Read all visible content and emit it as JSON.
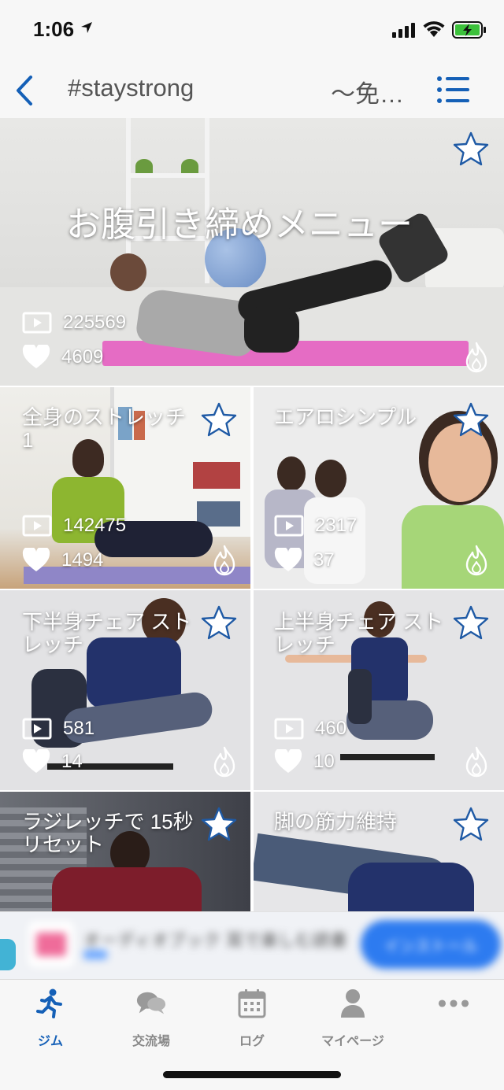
{
  "status": {
    "time": "1:06"
  },
  "nav": {
    "title": "#staystrong",
    "subtitle": "〜免…"
  },
  "hero": {
    "title": "お腹引き締めメニュー",
    "plays": "225569",
    "likes": "4609"
  },
  "cards": [
    {
      "title": "全身のストレッチ1",
      "plays": "142475",
      "likes": "1494"
    },
    {
      "title": "エアロシンプル",
      "plays": "2317",
      "likes": "37"
    },
    {
      "title": "下半身チェア ストレッチ",
      "plays": "581",
      "likes": "14"
    },
    {
      "title": "上半身チェア ストレッチ",
      "plays": "460",
      "likes": "10"
    },
    {
      "title": "ラジレッチで 15秒リセット",
      "plays": "",
      "likes": ""
    },
    {
      "title": "脚の筋力維持",
      "plays": "",
      "likes": ""
    }
  ],
  "ad": {
    "text": "オーディオブック 耳で楽しむ読書",
    "cta": "インストール"
  },
  "tabs": [
    {
      "label": "ジム",
      "icon": "runner-icon",
      "active": true
    },
    {
      "label": "交流場",
      "icon": "chat-bubbles-icon",
      "active": false
    },
    {
      "label": "ログ",
      "icon": "calendar-icon",
      "active": false
    },
    {
      "label": "マイページ",
      "icon": "person-icon",
      "active": false
    },
    {
      "label": "",
      "icon": "more-dots-icon",
      "active": false
    }
  ],
  "colors": {
    "accent": "#1560b7",
    "inactive": "#888888",
    "mat_pink": "#e56cc4",
    "ad_cta": "#2d7bf0"
  }
}
